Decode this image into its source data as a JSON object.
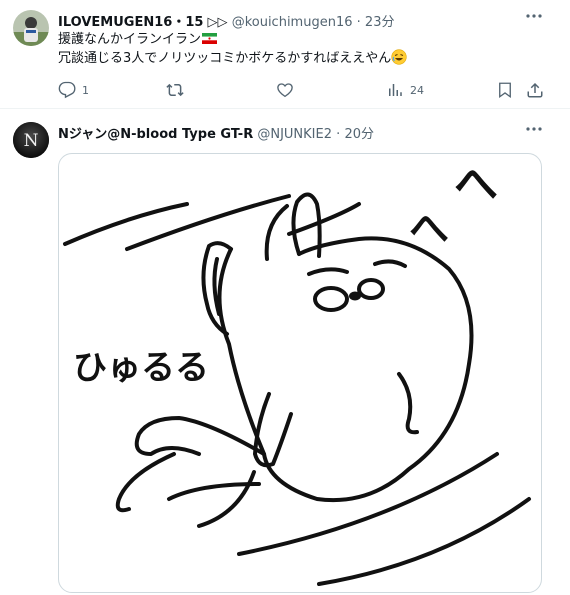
{
  "tweet1": {
    "display_name": "ILOVEMUGEN16・15",
    "name_suffix_icons": "▷▷",
    "handle": "@kouichimugen16",
    "separator": "·",
    "time": "23分",
    "line1": "援護なんかイランイラン",
    "line1_emoji": "iran-flag",
    "line2": "冗談通じる3人でノリツッコミかボケるかすればええやん",
    "line2_emoji": "rolling-on-floor-laughing",
    "reply_count": "1",
    "view_count": "24"
  },
  "tweet2": {
    "avatar_letter": "N",
    "display_name": "Nジャン@N-blood Type GT-R",
    "handle": "@NJUNKIE2",
    "separator": "·",
    "time": "20分",
    "image": {
      "description_text_left": "ひゅるる",
      "description_text_right_1": "へ",
      "description_text_right_2": "へ"
    }
  },
  "icons": {
    "more": "more-horizontal-icon",
    "reply": "reply-icon",
    "retweet": "retweet-icon",
    "like": "like-icon",
    "views": "views-icon",
    "bookmark": "bookmark-icon",
    "share": "share-icon"
  },
  "colors": {
    "text": "#0f1419",
    "secondary": "#536471",
    "border": "#cfd9de"
  }
}
